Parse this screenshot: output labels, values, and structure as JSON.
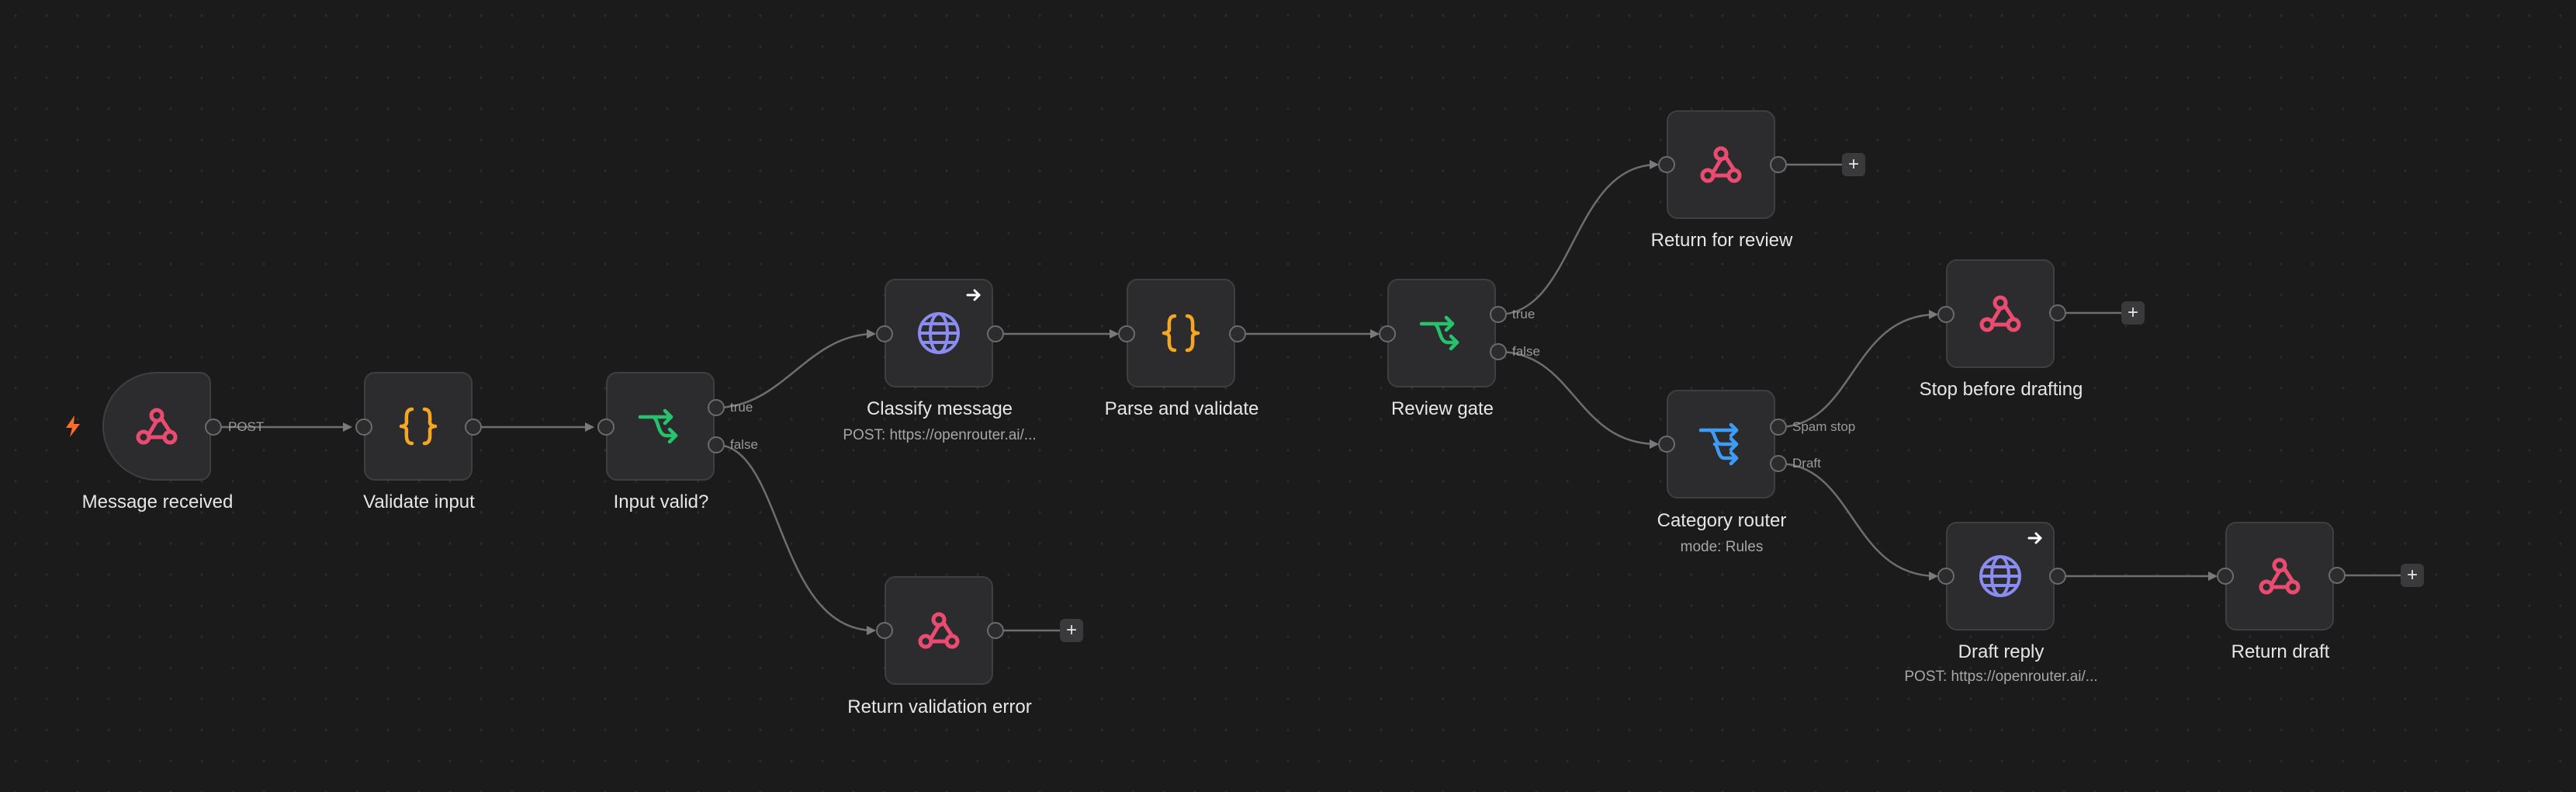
{
  "colors": {
    "background": "#1b1b1c",
    "node_fill": "#2c2c2e",
    "node_border": "#3f3f42",
    "webhook_icon": "#ea4b71",
    "code_icon": "#f5a623",
    "if_icon": "#27c26b",
    "http_icon": "#8a8cf0",
    "switch_icon": "#3e9cf6",
    "trigger_bolt": "#ff6d2b"
  },
  "nodes": [
    {
      "id": "message_received",
      "label": "Message received",
      "icon": "webhook-icon",
      "type": "trigger"
    },
    {
      "id": "validate_input",
      "label": "Validate input",
      "icon": "code-braces-icon"
    },
    {
      "id": "input_valid",
      "label": "Input valid?",
      "icon": "if-branch-icon"
    },
    {
      "id": "classify_message",
      "label": "Classify message",
      "sublabel": "POST: https://openrouter.ai/...",
      "icon": "globe-icon"
    },
    {
      "id": "return_validation_error",
      "label": "Return validation error",
      "icon": "webhook-icon"
    },
    {
      "id": "parse_and_validate",
      "label": "Parse and validate",
      "icon": "code-braces-icon"
    },
    {
      "id": "review_gate",
      "label": "Review gate",
      "icon": "if-branch-icon"
    },
    {
      "id": "return_for_review",
      "label": "Return for review",
      "icon": "webhook-icon"
    },
    {
      "id": "category_router",
      "label": "Category router",
      "sublabel": "mode: Rules",
      "icon": "switch-router-icon"
    },
    {
      "id": "stop_before_drafting",
      "label": "Stop before drafting",
      "icon": "webhook-icon"
    },
    {
      "id": "draft_reply",
      "label": "Draft reply",
      "sublabel": "POST: https://openrouter.ai/...",
      "icon": "globe-icon"
    },
    {
      "id": "return_draft",
      "label": "Return draft",
      "icon": "webhook-icon"
    }
  ],
  "port_labels": {
    "post": "POST",
    "input_true": "true",
    "input_false": "false",
    "review_true": "true",
    "review_false": "false",
    "spam_stop": "Spam stop",
    "draft": "Draft"
  },
  "add_button_label": "+"
}
